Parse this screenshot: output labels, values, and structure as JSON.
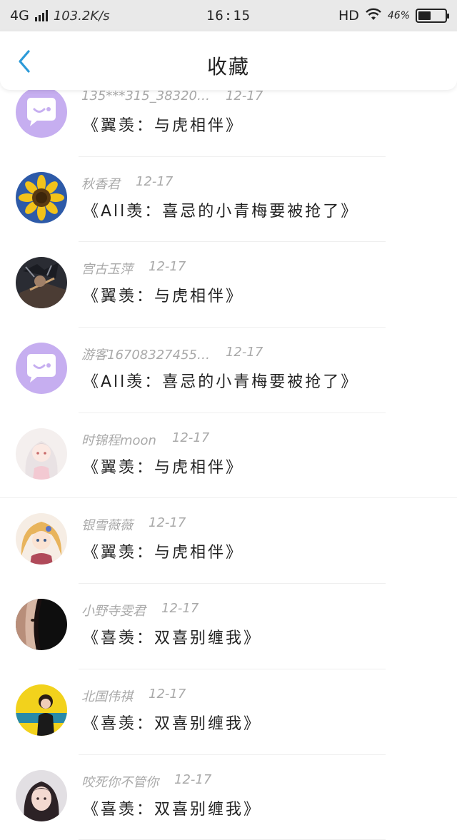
{
  "status_bar": {
    "network": "4G",
    "speed": "103.2K/s",
    "time": "16:15",
    "hd": "HD",
    "battery_percent": "46%",
    "battery_level": 0.46
  },
  "nav": {
    "title": "收藏",
    "back_icon": "chevron-left-icon",
    "accent_color": "#2c9ad8"
  },
  "items": [
    {
      "username": "135***315_38320…",
      "date": "12-17",
      "title": "《翼羡：与虎相伴》",
      "avatar": "chat-bubble-placeholder"
    },
    {
      "username": "秋香君",
      "date": "12-17",
      "title": "《All羡：喜忌的小青梅要被抢了》",
      "avatar": "sunflower-photo"
    },
    {
      "username": "宫古玉萍",
      "date": "12-17",
      "title": "《翼羡：与虎相伴》",
      "avatar": "dark-anime-photo"
    },
    {
      "username": "游客16708327455…",
      "date": "12-17",
      "title": "《All羡：喜忌的小青梅要被抢了》",
      "avatar": "chat-bubble-placeholder"
    },
    {
      "username": "时锦程moon",
      "date": "12-17",
      "title": "《翼羡：与虎相伴》",
      "avatar": "anime-girl-white-photo"
    },
    {
      "username": "银雪薇薇",
      "date": "12-17",
      "title": "《翼羡：与虎相伴》",
      "avatar": "anime-girl-blonde-photo"
    },
    {
      "username": "小野寺雯君",
      "date": "12-17",
      "title": "《喜羡：双喜别缠我》",
      "avatar": "dark-face-photo"
    },
    {
      "username": "北国伟祺",
      "date": "12-17",
      "title": "《喜羡：双喜别缠我》",
      "avatar": "yellow-girl-photo"
    },
    {
      "username": "咬死你不管你",
      "date": "12-17",
      "title": "《喜羡：双喜别缠我》",
      "avatar": "girl-portrait-photo"
    }
  ]
}
